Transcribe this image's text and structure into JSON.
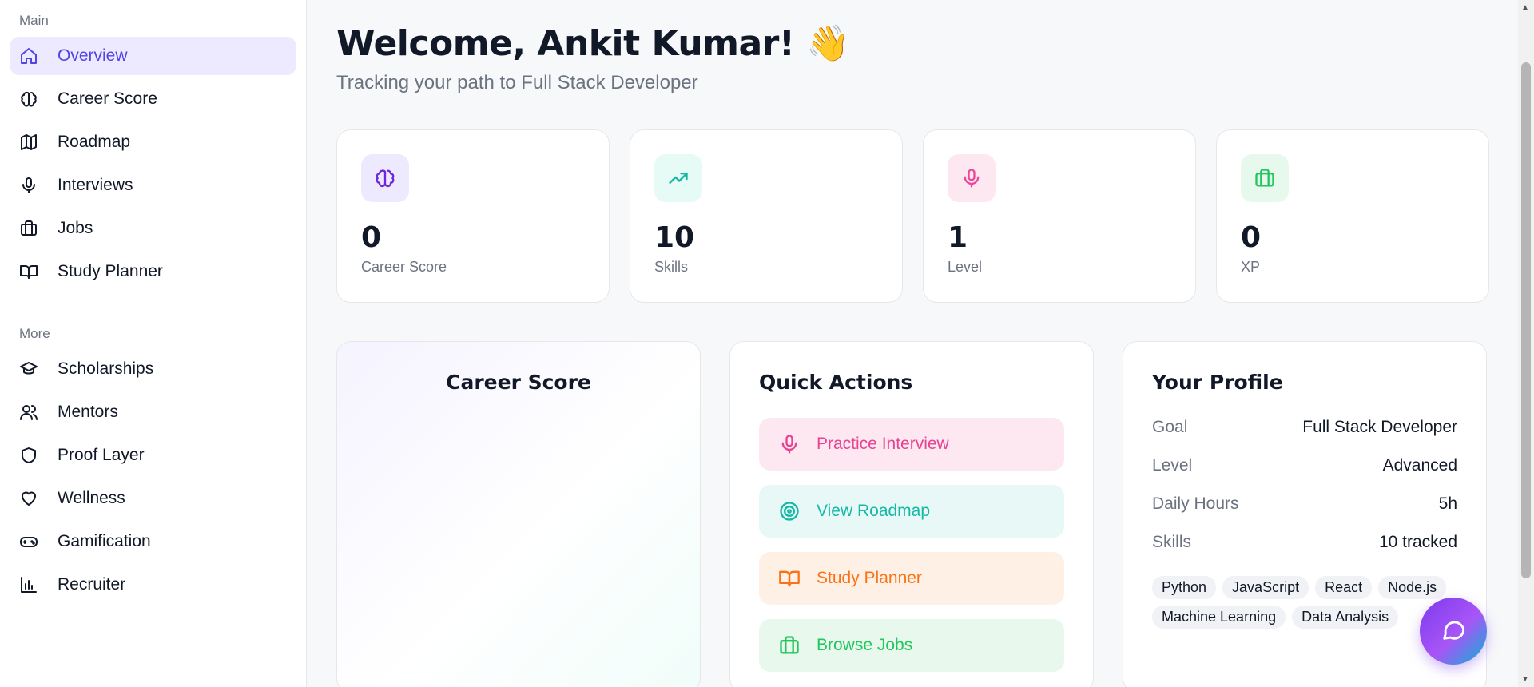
{
  "sidebar": {
    "main_label": "Main",
    "more_label": "More",
    "main_items": [
      {
        "label": "Overview",
        "icon": "home-icon",
        "active": true
      },
      {
        "label": "Career Score",
        "icon": "brain-icon"
      },
      {
        "label": "Roadmap",
        "icon": "map-icon"
      },
      {
        "label": "Interviews",
        "icon": "mic-icon"
      },
      {
        "label": "Jobs",
        "icon": "briefcase-icon"
      },
      {
        "label": "Study Planner",
        "icon": "book-icon"
      }
    ],
    "more_items": [
      {
        "label": "Scholarships",
        "icon": "graduation-cap-icon"
      },
      {
        "label": "Mentors",
        "icon": "users-icon"
      },
      {
        "label": "Proof Layer",
        "icon": "shield-icon"
      },
      {
        "label": "Wellness",
        "icon": "heart-icon"
      },
      {
        "label": "Gamification",
        "icon": "gamepad-icon"
      },
      {
        "label": "Recruiter",
        "icon": "bar-chart-icon"
      }
    ]
  },
  "header": {
    "title": "Welcome, Ankit Kumar! 👋",
    "subtitle": "Tracking your path to Full Stack Developer"
  },
  "stats": [
    {
      "value": "0",
      "label": "Career Score",
      "icon": "brain-icon",
      "color": "#6d28d9",
      "bg": "#ede9fe"
    },
    {
      "value": "10",
      "label": "Skills",
      "icon": "trending-up-icon",
      "color": "#14b8a6",
      "bg": "#e6faf6"
    },
    {
      "value": "1",
      "label": "Level",
      "icon": "mic-icon",
      "color": "#ec4899",
      "bg": "#fde7f1"
    },
    {
      "value": "0",
      "label": "XP",
      "icon": "briefcase-icon",
      "color": "#22c55e",
      "bg": "#e7f8ec"
    }
  ],
  "career_score_panel": {
    "title": "Career Score"
  },
  "quick_actions": {
    "title": "Quick Actions",
    "items": [
      {
        "label": "Practice Interview",
        "icon": "mic-icon",
        "color": "#e84393",
        "bg": "#fde8f1"
      },
      {
        "label": "View Roadmap",
        "icon": "target-icon",
        "color": "#14b8a6",
        "bg": "#e7f8f6"
      },
      {
        "label": "Study Planner",
        "icon": "book-icon",
        "color": "#f97316",
        "bg": "#fff0e6"
      },
      {
        "label": "Browse Jobs",
        "icon": "briefcase-icon",
        "color": "#22c55e",
        "bg": "#e8f8ec"
      }
    ]
  },
  "profile": {
    "title": "Your Profile",
    "rows": [
      {
        "key": "Goal",
        "value": "Full Stack Developer"
      },
      {
        "key": "Level",
        "value": "Advanced"
      },
      {
        "key": "Daily Hours",
        "value": "5h"
      },
      {
        "key": "Skills",
        "value": "10 tracked"
      }
    ],
    "tags": [
      "Python",
      "JavaScript",
      "React",
      "Node.js",
      "Machine Learning",
      "Data Analysis"
    ]
  },
  "chat_button": {
    "icon": "chat-icon"
  }
}
